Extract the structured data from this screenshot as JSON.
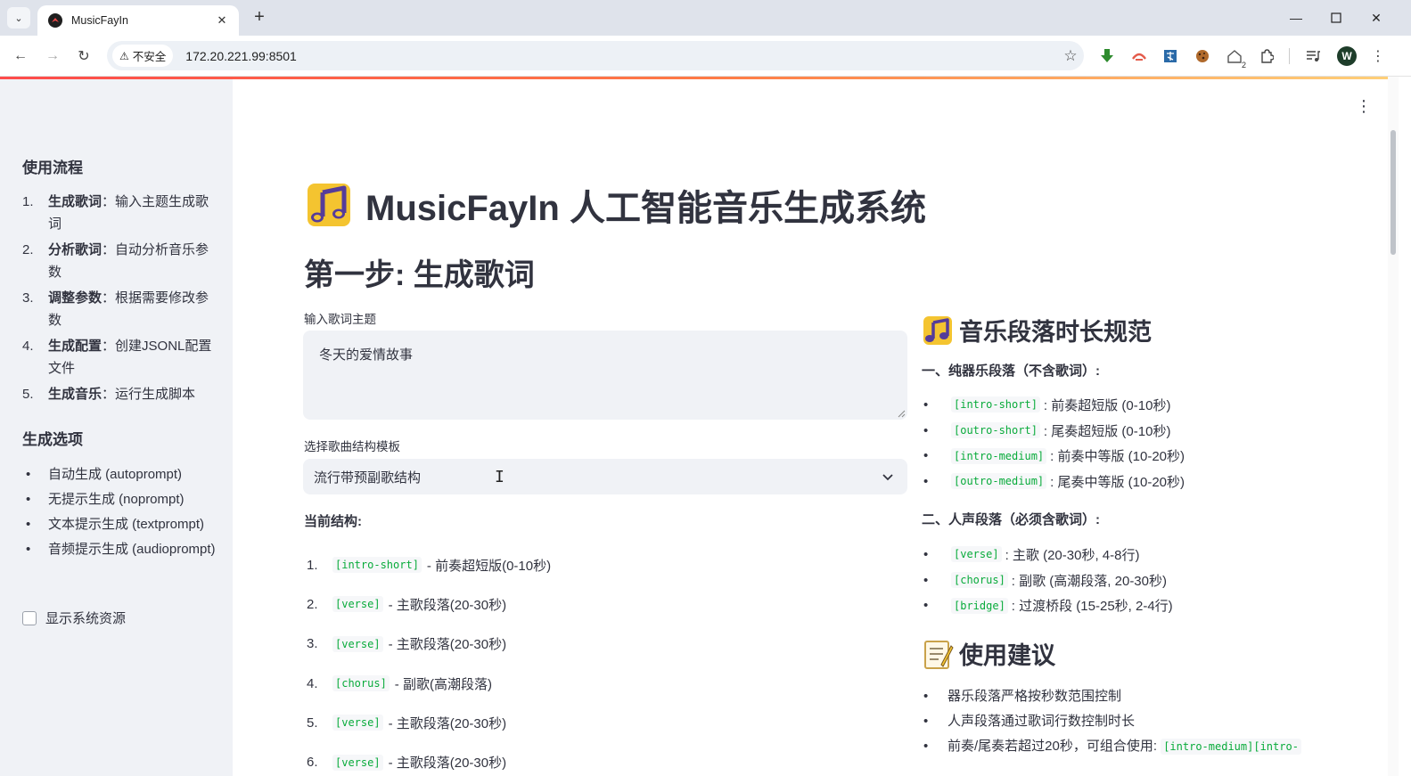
{
  "browser": {
    "tab_title": "MusicFayIn",
    "insecure_label": "不安全",
    "url": "172.20.221.99:8501",
    "profile_initial": "W",
    "extension_badge": "2"
  },
  "sidebar": {
    "workflow_heading": "使用流程",
    "workflow_steps": [
      {
        "num": "1.",
        "title": "生成歌词",
        "desc": "：输入主题生成歌词"
      },
      {
        "num": "2.",
        "title": "分析歌词",
        "desc": "：自动分析音乐参数"
      },
      {
        "num": "3.",
        "title": "调整参数",
        "desc": "：根据需要修改参数"
      },
      {
        "num": "4.",
        "title": "生成配置",
        "desc": "：创建JSONL配置文件"
      },
      {
        "num": "5.",
        "title": "生成音乐",
        "desc": "：运行生成脚本"
      }
    ],
    "options_heading": "生成选项",
    "options": [
      "自动生成 (autoprompt)",
      "无提示生成 (noprompt)",
      "文本提示生成 (textprompt)",
      "音频提示生成 (audioprompt)"
    ],
    "show_resources_label": "显示系统资源",
    "show_resources_checked": false
  },
  "main": {
    "title": "MusicFayIn 人工智能音乐生成系统",
    "step_heading": "第一步: 生成歌词",
    "theme_label": "输入歌词主题",
    "theme_value": "冬天的爱情故事",
    "template_label": "选择歌曲结构模板",
    "template_value": "流行带预副歌结构",
    "current_structure_label": "当前结构:",
    "structure": [
      {
        "num": "1.",
        "tag": "[intro-short]",
        "desc": "- 前奏超短版(0-10秒)"
      },
      {
        "num": "2.",
        "tag": "[verse]",
        "desc": "- 主歌段落(20-30秒)"
      },
      {
        "num": "3.",
        "tag": "[verse]",
        "desc": "- 主歌段落(20-30秒)"
      },
      {
        "num": "4.",
        "tag": "[chorus]",
        "desc": "- 副歌(高潮段落)"
      },
      {
        "num": "5.",
        "tag": "[verse]",
        "desc": "- 主歌段落(20-30秒)"
      },
      {
        "num": "6.",
        "tag": "[verse]",
        "desc": "- 主歌段落(20-30秒)"
      }
    ]
  },
  "spec": {
    "heading": "音乐段落时长规范",
    "instrumental_heading": "一、纯器乐段落（不含歌词）:",
    "instrumental": [
      {
        "tag": "[intro-short]",
        "desc": ": 前奏超短版 (0-10秒)"
      },
      {
        "tag": "[outro-short]",
        "desc": ": 尾奏超短版 (0-10秒)"
      },
      {
        "tag": "[intro-medium]",
        "desc": ": 前奏中等版 (10-20秒)"
      },
      {
        "tag": "[outro-medium]",
        "desc": ": 尾奏中等版 (10-20秒)"
      }
    ],
    "vocal_heading": "二、人声段落（必须含歌词）:",
    "vocal": [
      {
        "tag": "[verse]",
        "desc": ": 主歌 (20-30秒, 4-8行)"
      },
      {
        "tag": "[chorus]",
        "desc": ": 副歌 (高潮段落, 20-30秒)"
      },
      {
        "tag": "[bridge]",
        "desc": ": 过渡桥段 (15-25秒, 2-4行)"
      }
    ]
  },
  "tips": {
    "heading": "使用建议",
    "items": [
      "器乐段落严格按秒数范围控制",
      "人声段落通过歌词行数控制时长"
    ],
    "combo_text": "前奏/尾奏若超过20秒，可组合使用:",
    "combo_code": "[intro-medium][intro-"
  },
  "icons": {
    "accent": "#09ab3b",
    "note_purple": "#553c9a",
    "note_yellow": "#f4c430",
    "loading_bar_start": "#ff4b4b"
  }
}
